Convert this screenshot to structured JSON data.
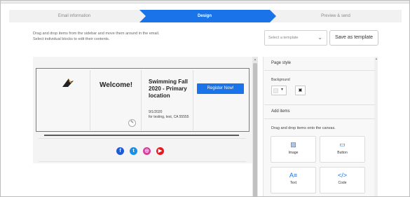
{
  "steps": {
    "items": [
      {
        "label": "Email information"
      },
      {
        "label": "Design"
      },
      {
        "label": "Preview & send"
      }
    ]
  },
  "instructions": {
    "line1": "Drag and drop items from the sidebar and move them around in the email.",
    "line2": "Select individual blocks to edit their contents."
  },
  "toolbar": {
    "template_placeholder": "Select a template",
    "save_label": "Save as template"
  },
  "email": {
    "welcome": "Welcome!",
    "event_title": "Swimming Fall 2020 - Primary location",
    "event_date": "9/1/2020",
    "event_location": "for testing, test, CA 55555",
    "register_label": "Register Now!"
  },
  "social": [
    "facebook",
    "twitter",
    "instagram",
    "youtube"
  ],
  "panel": {
    "page_style_title": "Page style",
    "background_label": "Background",
    "add_items_title": "Add items",
    "drag_hint": "Drag and drop items onto the canvas.",
    "tiles": [
      {
        "label": "Image",
        "icon": "image-icon"
      },
      {
        "label": "Button",
        "icon": "button-icon"
      },
      {
        "label": "Text",
        "icon": "text-icon"
      },
      {
        "label": "Code",
        "icon": "code-icon"
      }
    ]
  },
  "colors": {
    "accent": "#1a73e8",
    "selection": "#e05252"
  }
}
